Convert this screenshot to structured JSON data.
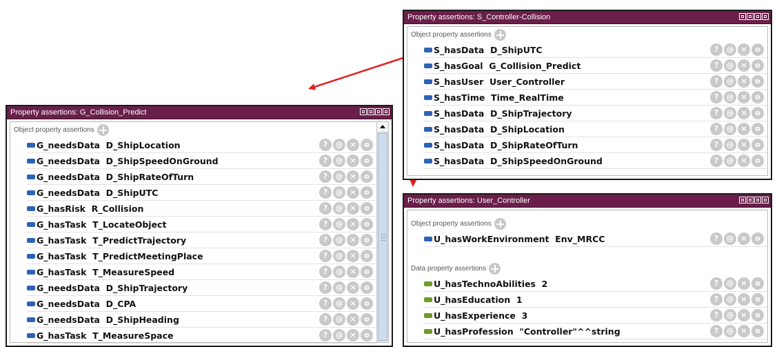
{
  "colors": {
    "titlebar": "#6a1f4a",
    "object_marker": "#2d63b5",
    "data_marker": "#6d9b2a",
    "arrow": "#e02020"
  },
  "icons": {
    "window_controls": [
      "restore-icon",
      "minimize-icon",
      "maximize-icon",
      "close-icon"
    ],
    "row_actions": [
      "?",
      "@",
      "×",
      "o"
    ]
  },
  "panels": {
    "left": {
      "title": "Property assertions: G_Collision_Predict",
      "object_header": "Object property assertions",
      "object_rows": [
        "G_needsData  D_ShipLocation",
        "G_needsData  D_ShipSpeedOnGround",
        "G_needsData  D_ShipRateOfTurn",
        "G_needsData  D_ShipUTC",
        "G_hasRisk  R_Collision",
        "G_hasTask  T_LocateObject",
        "G_hasTask  T_PredictTrajectory",
        "G_hasTask  T_PredictMeetingPlace",
        "G_hasTask  T_MeasureSpeed",
        "G_needsData  D_ShipTrajectory",
        "G_needsData  D_CPA",
        "G_needsData  D_ShipHeading",
        "G_hasTask  T_MeasureSpace"
      ]
    },
    "top_right": {
      "title": "Property assertions: S_Controller-Collision",
      "object_header": "Object property assertions",
      "object_rows": [
        "S_hasData  D_ShipUTC",
        "S_hasGoal  G_Collision_Predict",
        "S_hasUser  User_Controller",
        "S_hasTime  Time_RealTime",
        "S_hasData  D_ShipTrajectory",
        "S_hasData  D_ShipLocation",
        "S_hasData  D_ShipRateOfTurn",
        "S_hasData  D_ShipSpeedOnGround"
      ]
    },
    "bottom_right": {
      "title": "Property assertions: User_Controller",
      "object_header": "Object property assertions",
      "object_rows": [
        "U_hasWorkEnvironment  Env_MRCC"
      ],
      "data_header": "Data property assertions",
      "data_rows": [
        "U_hasTechnoAbilities  2",
        "U_hasEducation  1",
        "U_hasExperience  3",
        "U_hasProfession  \"Controller\"^^string"
      ]
    }
  }
}
